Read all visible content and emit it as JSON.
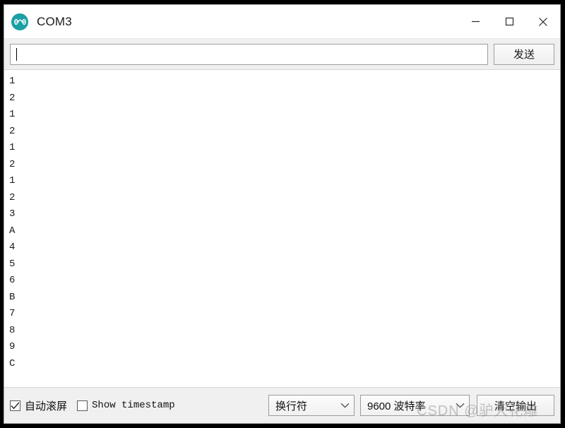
{
  "window": {
    "title": "COM3",
    "logo_icon": "arduino-infinity-icon",
    "controls": [
      {
        "name": "minimize-button",
        "icon": "minimize-icon"
      },
      {
        "name": "maximize-button",
        "icon": "maximize-icon"
      },
      {
        "name": "close-button",
        "icon": "close-icon"
      }
    ]
  },
  "send_bar": {
    "input_value": "",
    "input_placeholder": "",
    "send_label": "发送"
  },
  "output": {
    "lines": [
      "1",
      "2",
      "1",
      "2",
      "1",
      "2",
      "1",
      "2",
      "3",
      "A",
      "4",
      "5",
      "6",
      "B",
      "7",
      "8",
      "9",
      "C"
    ]
  },
  "status_bar": {
    "autoscroll_label": "自动滚屏",
    "autoscroll_checked": true,
    "timestamp_label": "Show timestamp",
    "timestamp_checked": false,
    "newline_value": "换行符",
    "baud_value": "9600 波特率",
    "clear_label": "清空输出"
  },
  "watermark": {
    "text": "CSDN @驴大花雕"
  },
  "colors": {
    "accent": "#1ba0a4",
    "window_bg": "#ffffff",
    "chrome_bg": "#f0f0f0",
    "text": "#1a1a1a"
  }
}
